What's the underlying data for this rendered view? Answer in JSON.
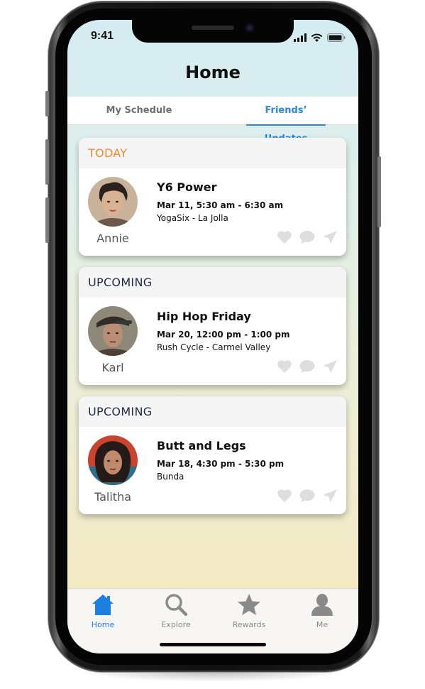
{
  "status_bar": {
    "time": "9:41"
  },
  "header": {
    "title": "Home"
  },
  "tabs": {
    "left_label": "My Schedule",
    "right_label": "Friends’ Updates",
    "active": "Friends’ Updates"
  },
  "cards": [
    {
      "section": "TODAY",
      "section_color": "#f08c2e",
      "friend": "Annie",
      "class_name": "Y6 Power",
      "time": "Mar 11, 5:30 am - 6:30 am",
      "venue": "YogaSix - La Jolla"
    },
    {
      "section": "UPCOMING",
      "section_color": "#1f2a44",
      "friend": "Karl",
      "class_name": "Hip Hop Friday",
      "time": "Mar 20, 12:00 pm - 1:00 pm",
      "venue": "Rush Cycle - Carmel Valley"
    },
    {
      "section": "UPCOMING",
      "section_color": "#1f2a44",
      "friend": "Talitha",
      "class_name": "Butt and Legs",
      "time": "Mar 18, 4:30 pm - 5:30 pm",
      "venue": "Bunda"
    }
  ],
  "card_actions": [
    "heart-icon",
    "comment-icon",
    "send-icon"
  ],
  "tab_bar": {
    "items": [
      {
        "label": "Home",
        "icon": "home-icon",
        "active": true
      },
      {
        "label": "Explore",
        "icon": "search-icon",
        "active": false
      },
      {
        "label": "Rewards",
        "icon": "star-icon",
        "active": false
      },
      {
        "label": "Me",
        "icon": "person-icon",
        "active": false
      }
    ],
    "active_color": "#1d7fe0",
    "inactive_color": "#8a8a8a"
  }
}
